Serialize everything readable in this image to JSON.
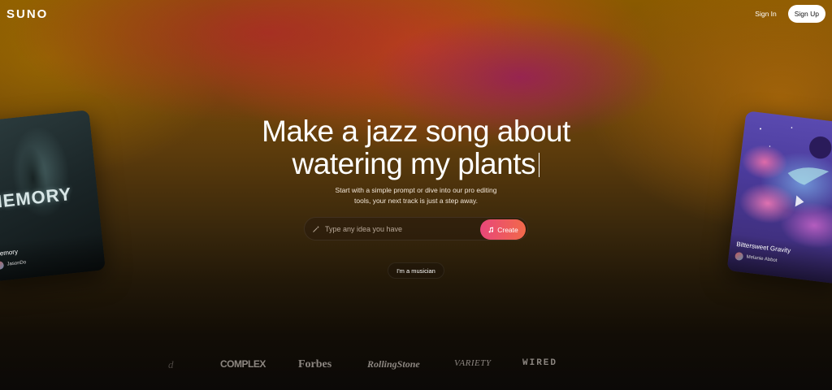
{
  "header": {
    "logo": "SUNO",
    "sign_in": "Sign In",
    "sign_up": "Sign Up"
  },
  "hero": {
    "headline_line1": "Make a jazz song about",
    "headline_line2": "watering my plants",
    "subtitle_line1": "Start with a simple prompt or dive into our pro editing",
    "subtitle_line2": "tools, your next track is just a step away."
  },
  "prompt": {
    "placeholder": "Type any idea you have",
    "value": "",
    "create_label": "Create",
    "icon": "wand-icon"
  },
  "musician_label": "I'm a musician",
  "cards": {
    "left": {
      "art_text": "MEMORY",
      "title": "Memory",
      "author": "JasonDo"
    },
    "right": {
      "title": "Bittersweet Gravity",
      "author": "Melanie Abbot"
    }
  },
  "press": [
    "d",
    "COMPLEX",
    "Forbes",
    "RollingStone",
    "VARIETY",
    "WIRED"
  ],
  "colors": {
    "create_start": "#e8477a",
    "create_end": "#f2694a",
    "signup_bg": "#ffffff"
  }
}
